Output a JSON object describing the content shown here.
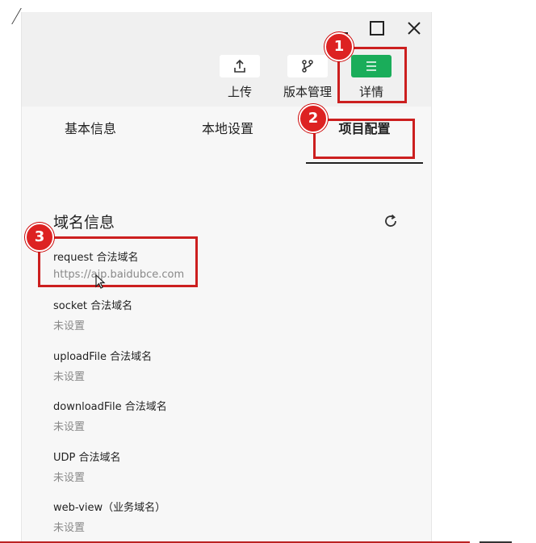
{
  "window": {
    "toolbar": {
      "upload_label": "上传",
      "version_label": "版本管理",
      "detail_label": "详情"
    },
    "tabs": [
      {
        "label": "基本信息"
      },
      {
        "label": "本地设置"
      },
      {
        "label": "项目配置"
      }
    ],
    "domain_section": {
      "title": "域名信息",
      "fields": [
        {
          "label": "request 合法域名",
          "value": "https://aip.baidubce.com"
        },
        {
          "label": "socket 合法域名",
          "value": "未设置"
        },
        {
          "label": "uploadFile 合法域名",
          "value": "未设置"
        },
        {
          "label": "downloadFile 合法域名",
          "value": "未设置"
        },
        {
          "label": "UDP 合法域名",
          "value": "未设置"
        },
        {
          "label": "web-view（业务域名）",
          "value": "未设置"
        }
      ]
    }
  },
  "annotations": {
    "badges": [
      "1",
      "2",
      "3"
    ]
  },
  "colors": {
    "detail_button": "#1aad5a",
    "annotation_red": "#cc1f1f",
    "active_tab_underline": "#222222"
  }
}
